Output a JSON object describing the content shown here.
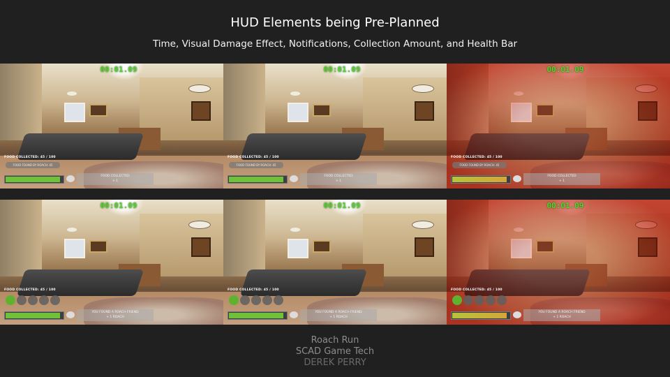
{
  "header": {
    "title": "HUD Elements being Pre-Planned",
    "subtitle": "Time, Visual Damage Effect, Notifications, Collection Amount, and Health Bar"
  },
  "hud": {
    "timer": "00:01.09",
    "collected_label": "FOOD COLLECTED: 45 / 100",
    "found_message_top": "FOOD FOUND BY ROACH: 45",
    "notif_top_line1": "FOOD COLLECTED",
    "notif_top_line2": "+ 1",
    "notif_bottom_line1": "YOU FOUND A ROACH FRIEND",
    "notif_bottom_line2": "+ 1 ROACH"
  },
  "screens": [
    {
      "row": "top",
      "health": 0.95,
      "damage": false
    },
    {
      "row": "top",
      "health": 0.95,
      "damage": false
    },
    {
      "row": "top",
      "health": 0.95,
      "damage": true
    },
    {
      "row": "bottom",
      "health": 0.95,
      "damage": false,
      "roach_slots_filled": 1,
      "roach_slots_total": 5
    },
    {
      "row": "bottom",
      "health": 0.95,
      "damage": false,
      "roach_slots_filled": 1,
      "roach_slots_total": 5
    },
    {
      "row": "bottom",
      "health": 0.95,
      "damage": true,
      "roach_slots_filled": 1,
      "roach_slots_total": 5
    }
  ],
  "colors": {
    "background": "#202020",
    "timer": "#5bd134",
    "health": "#6fc13a",
    "damage": "#c8281a"
  },
  "footer": {
    "line1": "Roach Run",
    "line2": "SCAD Game Tech",
    "line3": "DEREK PERRY"
  }
}
